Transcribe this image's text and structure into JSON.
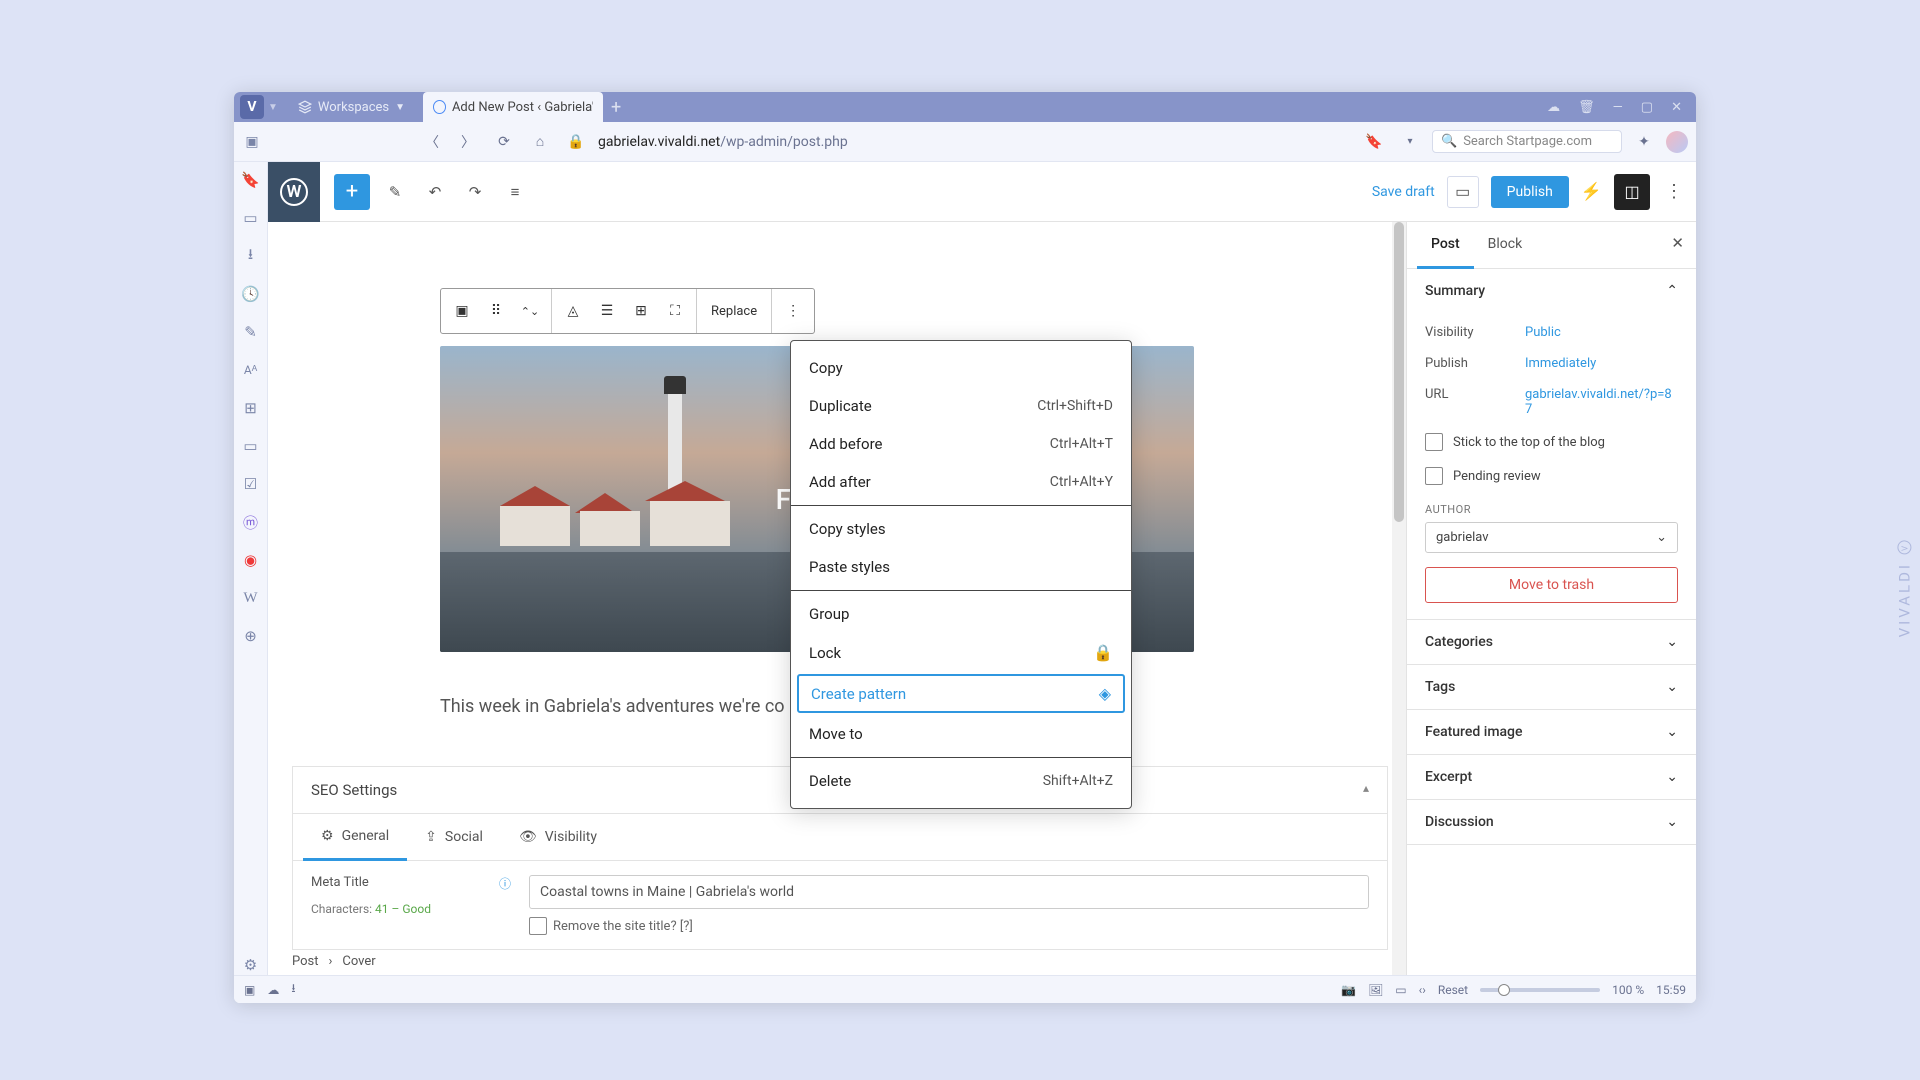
{
  "titlebar": {
    "workspaces_label": "Workspaces",
    "tab_title": "Add New Post ‹ Gabriela's -"
  },
  "addrbar": {
    "url_host": "gabrielav.vivaldi.net",
    "url_path": "/wp-admin/post.php",
    "search_placeholder": "Search Startpage.com"
  },
  "wp_toolbar": {
    "save_draft": "Save draft",
    "publish": "Publish"
  },
  "block_toolbar": {
    "replace": "Replace"
  },
  "cover": {
    "overlay_text": "FAL"
  },
  "post_body": "This week in Gabriela's adventures we're co",
  "seo": {
    "title": "SEO Settings",
    "tabs": {
      "general": "General",
      "social": "Social",
      "visibility": "Visibility"
    },
    "meta_title_label": "Meta Title",
    "chars_label": "Characters: ",
    "chars_value": "41 – Good",
    "meta_title_value": "Coastal towns in Maine | Gabriela's world",
    "remove_label": "Remove the site title? [?]"
  },
  "breadcrumb": {
    "a": "Post",
    "b": "Cover"
  },
  "context_menu": {
    "copy": "Copy",
    "duplicate": "Duplicate",
    "duplicate_k": "Ctrl+Shift+D",
    "add_before": "Add before",
    "add_before_k": "Ctrl+Alt+T",
    "add_after": "Add after",
    "add_after_k": "Ctrl+Alt+Y",
    "copy_styles": "Copy styles",
    "paste_styles": "Paste styles",
    "group": "Group",
    "lock": "Lock",
    "create_pattern": "Create pattern",
    "move_to": "Move to",
    "delete": "Delete",
    "delete_k": "Shift+Alt+Z"
  },
  "sidebar": {
    "tabs": {
      "post": "Post",
      "block": "Block"
    },
    "summary": {
      "title": "Summary",
      "visibility_k": "Visibility",
      "visibility_v": "Public",
      "publish_k": "Publish",
      "publish_v": "Immediately",
      "url_k": "URL",
      "url_v": "gabrielav.vivaldi.net/?p=87",
      "stick": "Stick to the top of the blog",
      "pending": "Pending review",
      "author_label": "AUTHOR",
      "author_value": "gabrielav",
      "trash": "Move to trash"
    },
    "sections": {
      "categories": "Categories",
      "tags": "Tags",
      "featured": "Featured image",
      "excerpt": "Excerpt",
      "discussion": "Discussion"
    }
  },
  "statusbar": {
    "reset": "Reset",
    "zoom": "100 %",
    "time": "15:59"
  },
  "watermark": "VIVALDI"
}
